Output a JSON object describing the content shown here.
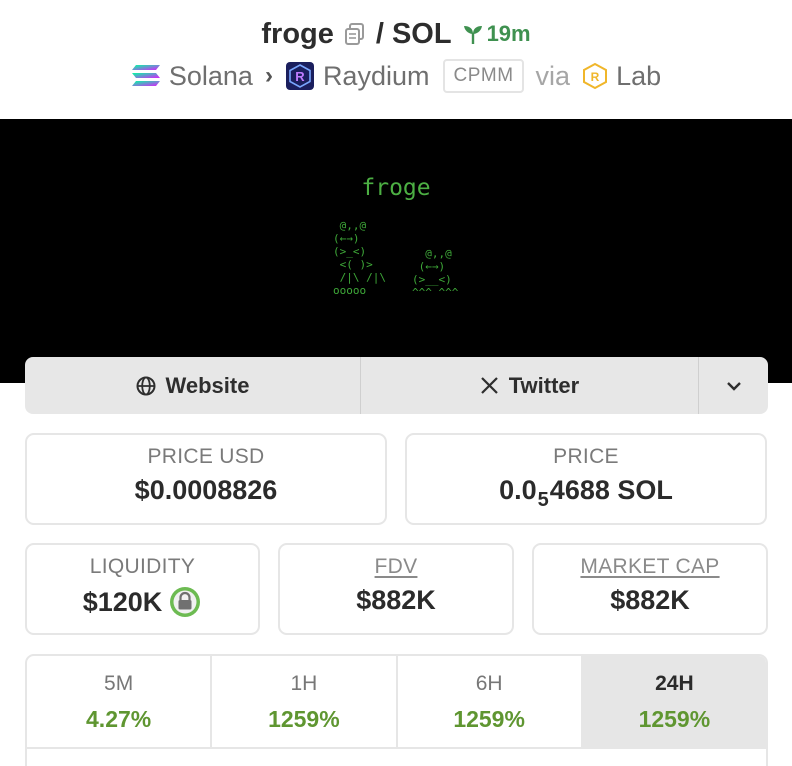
{
  "pair": {
    "base": "froge",
    "separator": "/",
    "quote": "SOL",
    "age": "19m"
  },
  "breadcrumb": {
    "chain": "Solana",
    "dex": "Raydium",
    "pool_type": "CPMM",
    "via_label": "via",
    "launchpad": "Lab"
  },
  "banner": {
    "title": "froge"
  },
  "links": {
    "website_label": "Website",
    "twitter_label": "Twitter"
  },
  "stats": {
    "price_usd_label": "PRICE USD",
    "price_usd": "$0.0008826",
    "price_label": "PRICE",
    "price_prefix": "0.0",
    "price_zeros": "5",
    "price_suffix": "4688 SOL",
    "liquidity_label": "LIQUIDITY",
    "liquidity": "$120K",
    "fdv_label": "FDV",
    "fdv": "$882K",
    "mcap_label": "MARKET CAP",
    "mcap": "$882K"
  },
  "timeframes": [
    {
      "period": "5M",
      "change": "4.27%",
      "active": false
    },
    {
      "period": "1H",
      "change": "1259%",
      "active": false
    },
    {
      "period": "6H",
      "change": "1259%",
      "active": false
    },
    {
      "period": "24H",
      "change": "1259%",
      "active": true
    }
  ],
  "colors": {
    "positive": "#5f9631",
    "age_badge": "#3f9150",
    "banner_text": "#4caf43",
    "lock_badge": "#6dbb52"
  },
  "icons": {
    "copy": "copy-icon",
    "age": "sprout-icon",
    "chain": "solana-logo-icon",
    "dex": "raydium-logo-icon",
    "launchpad": "raydium-lab-icon",
    "website": "globe-icon",
    "twitter": "x-logo-icon",
    "more": "chevron-down-icon",
    "liquidity": "lock-icon"
  }
}
